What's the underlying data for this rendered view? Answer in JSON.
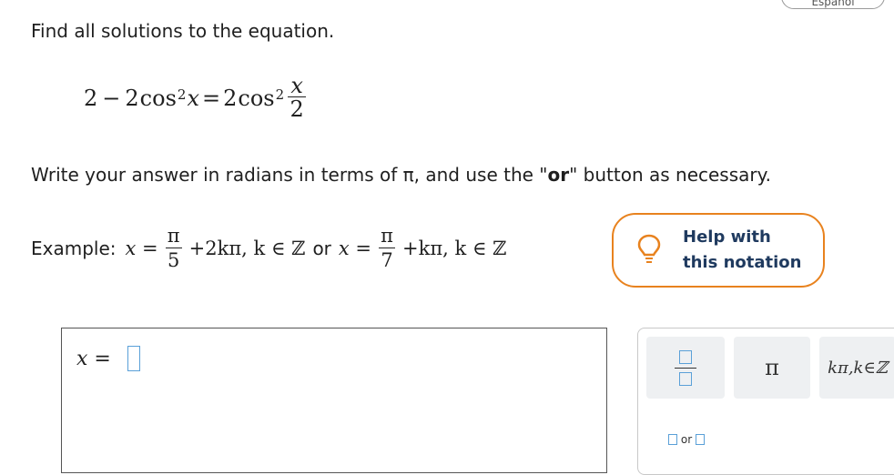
{
  "language_tab": "Español",
  "question": {
    "prompt": "Find all solutions to the equation.",
    "equation": {
      "lhs_constant": "2",
      "minus": "−",
      "coef": "2",
      "func": "cos",
      "exponent": "2",
      "var": "x",
      "equals": "=",
      "rhs_coef": "2",
      "rhs_func": "cos",
      "rhs_exponent": "2",
      "frac_num": "x",
      "frac_den": "2"
    },
    "instructions_pre": "Write your answer in radians in terms of π, and use the \"",
    "instructions_bold": "or",
    "instructions_post": "\" button as necessary."
  },
  "example": {
    "label": "Example:",
    "lhs1": "x =",
    "frac1_num": "π",
    "frac1_den": "5",
    "tail1": "+2kπ, k ∈ ℤ",
    "or": "or",
    "lhs2": "x =",
    "frac2_num": "π",
    "frac2_den": "7",
    "tail2": "+kπ, k ∈ ℤ"
  },
  "help_button": {
    "line1": "Help with",
    "line2": "this notation",
    "icon": "lightbulb-icon",
    "accent": "#e8821e"
  },
  "answer": {
    "label": "x ="
  },
  "palette": {
    "pi_label": "π",
    "kpi_label": "kπ,k∈ℤ",
    "or_label": "or"
  },
  "colors": {
    "input_border": "#5aa0d8",
    "button_bg": "#eef0f2"
  }
}
